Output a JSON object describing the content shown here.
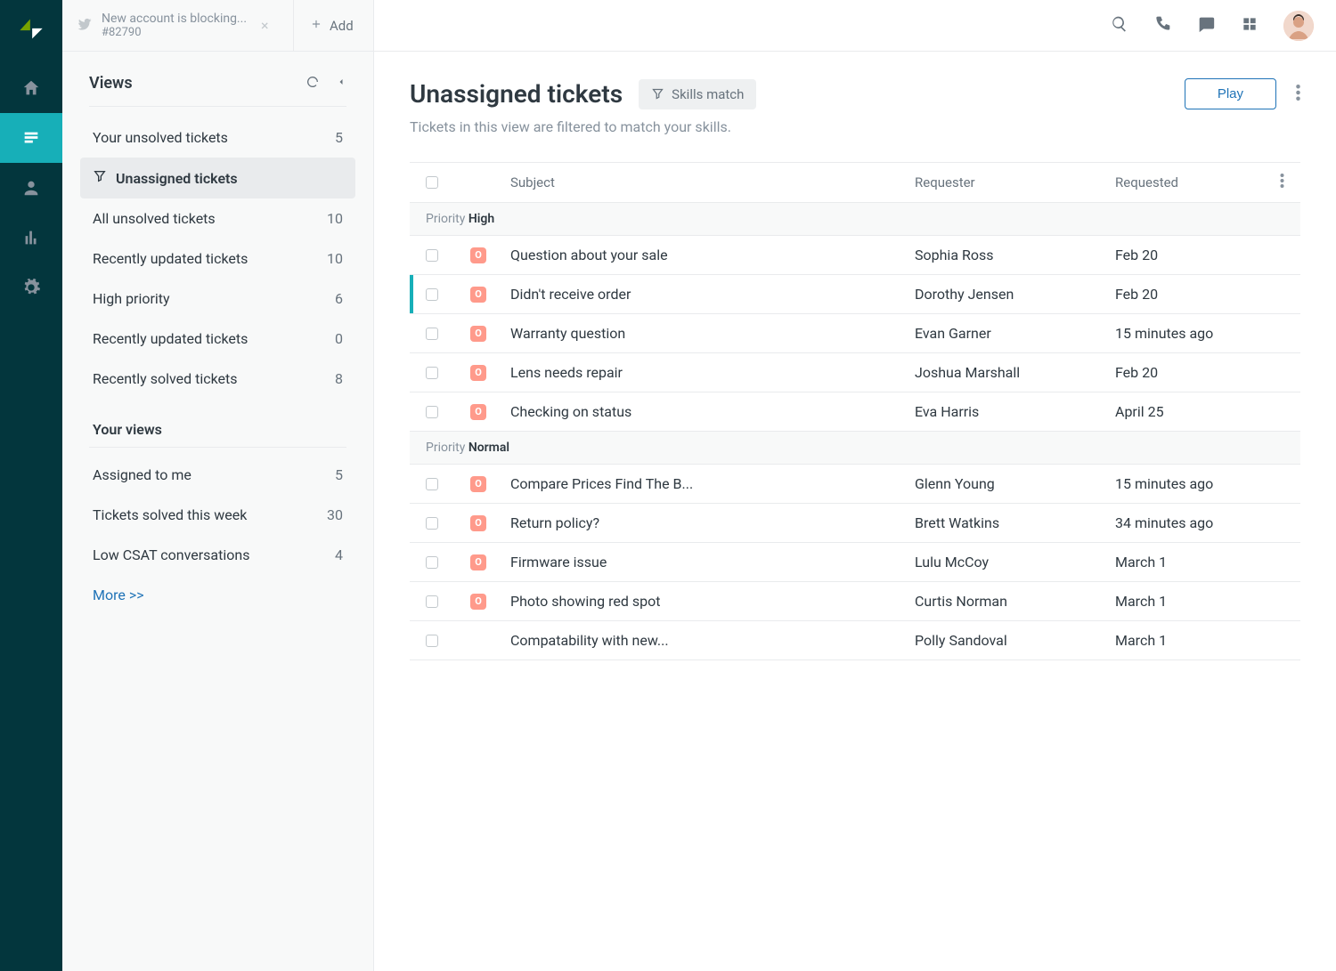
{
  "tab": {
    "title": "New account is blocking...",
    "sub": "#82790"
  },
  "add_label": "Add",
  "views_header": "Views",
  "system_views": [
    {
      "label": "Your unsolved tickets",
      "count": "5",
      "selected": false,
      "icon": false
    },
    {
      "label": "Unassigned tickets",
      "count": "",
      "selected": true,
      "icon": true
    },
    {
      "label": "All unsolved tickets",
      "count": "10",
      "selected": false,
      "icon": false
    },
    {
      "label": "Recently updated tickets",
      "count": "10",
      "selected": false,
      "icon": false
    },
    {
      "label": "High priority",
      "count": "6",
      "selected": false,
      "icon": false
    },
    {
      "label": "Recently updated tickets",
      "count": "0",
      "selected": false,
      "icon": false
    },
    {
      "label": "Recently solved tickets",
      "count": "8",
      "selected": false,
      "icon": false
    }
  ],
  "your_views_label": "Your views",
  "your_views": [
    {
      "label": "Assigned to me",
      "count": "5"
    },
    {
      "label": "Tickets solved this week",
      "count": "30"
    },
    {
      "label": "Low CSAT conversations",
      "count": "4"
    }
  ],
  "more_label": "More >>",
  "page_title": "Unassigned tickets",
  "skills_match": "Skills match",
  "play_label": "Play",
  "subtitle": "Tickets in this view are filtered to match your skills.",
  "columns": {
    "subject": "Subject",
    "requester": "Requester",
    "requested": "Requested"
  },
  "groups": [
    {
      "prefix": "Priority",
      "value": "High",
      "rows": [
        {
          "subject": "Question about your sale",
          "requester": "Sophia Ross",
          "requested": "Feb 20",
          "badge": "O",
          "marked": false
        },
        {
          "subject": "Didn't receive order",
          "requester": "Dorothy Jensen",
          "requested": "Feb 20",
          "badge": "O",
          "marked": true
        },
        {
          "subject": "Warranty question",
          "requester": "Evan Garner",
          "requested": "15 minutes ago",
          "badge": "O",
          "marked": false
        },
        {
          "subject": "Lens needs repair",
          "requester": "Joshua Marshall",
          "requested": "Feb 20",
          "badge": "O",
          "marked": false
        },
        {
          "subject": "Checking on status",
          "requester": "Eva Harris",
          "requested": "April 25",
          "badge": "O",
          "marked": false
        }
      ]
    },
    {
      "prefix": "Priority",
      "value": "Normal",
      "rows": [
        {
          "subject": "Compare Prices Find The B...",
          "requester": "Glenn Young",
          "requested": "15 minutes ago",
          "badge": "O",
          "marked": false
        },
        {
          "subject": "Return policy?",
          "requester": "Brett Watkins",
          "requested": "34 minutes ago",
          "badge": "O",
          "marked": false
        },
        {
          "subject": "Firmware issue",
          "requester": "Lulu McCoy",
          "requested": "March 1",
          "badge": "O",
          "marked": false
        },
        {
          "subject": "Photo showing red spot",
          "requester": "Curtis Norman",
          "requested": "March 1",
          "badge": "O",
          "marked": false
        },
        {
          "subject": "Compatability with new...",
          "requester": "Polly Sandoval",
          "requested": "March 1",
          "badge": "",
          "marked": false
        }
      ]
    }
  ]
}
